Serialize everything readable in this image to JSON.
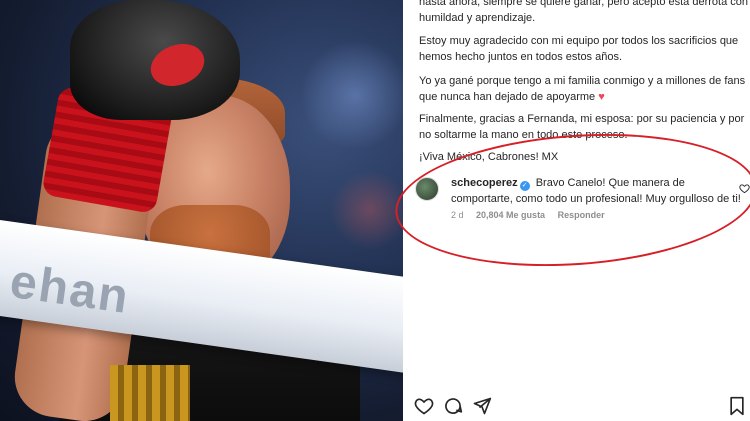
{
  "caption": {
    "clipped_top": "hasta ahora, siempre se quiere ganar, pero acepto esta derrota con humildad y aprendizaje.",
    "p1": "Estoy muy agradecido con mi equipo por todos los sacrificios que hemos hecho juntos en todos estos años.",
    "p2_text": "Yo ya gané porque tengo a mi familia conmigo y a millones de fans que nunca han dejado de apoyarme ",
    "p2_heart": "♥",
    "p3": "Finalmente, gracias a Fernanda, mi esposa: por su paciencia y por no soltarme la mano en todo este proceso.",
    "p4": "¡Viva México, Cabrones! MX"
  },
  "comment": {
    "username": "schecoperez",
    "verified_glyph": "✓",
    "text": "Bravo Canelo! Que manera de comportarte, como todo un profesional! Muy orgulloso de ti!",
    "age": "2 d",
    "likes": "20,804 Me gusta",
    "reply": "Responder"
  },
  "photo": {
    "rope_text": "ehan"
  },
  "icons": {
    "like": "heart-outline-icon",
    "comment": "comment-bubble-icon",
    "share": "paper-plane-icon",
    "save": "bookmark-icon"
  },
  "colors": {
    "highlight_oval": "#d61f26",
    "verified": "#3897f0",
    "heart": "#ed4956"
  }
}
